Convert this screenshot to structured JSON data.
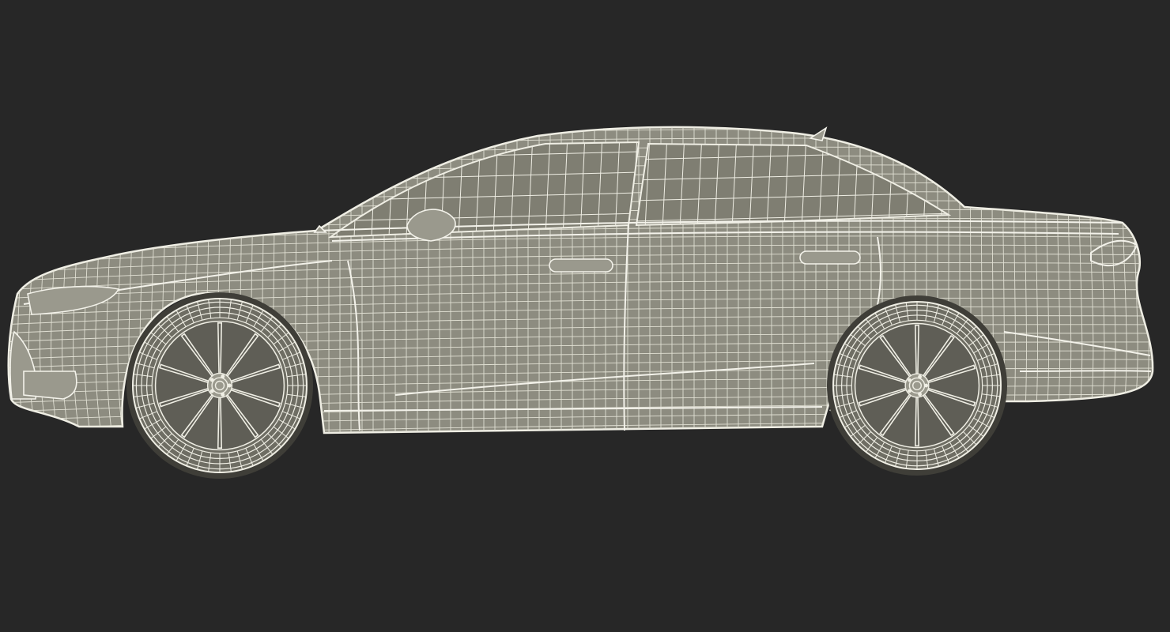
{
  "scene": {
    "subject": "",
    "render_style": "wireframe",
    "view": "side"
  },
  "colors": {
    "background": "#272727",
    "body_fill": "#8d8c80",
    "glass_fill": "#7f7e72",
    "wire": "#efeee4",
    "wire_dense": "#e6e5d8",
    "tire": "#6e6d63",
    "shadow": "#3f3e38"
  },
  "icons": [
    "car-wireframe-icon",
    "wheel-icon"
  ]
}
